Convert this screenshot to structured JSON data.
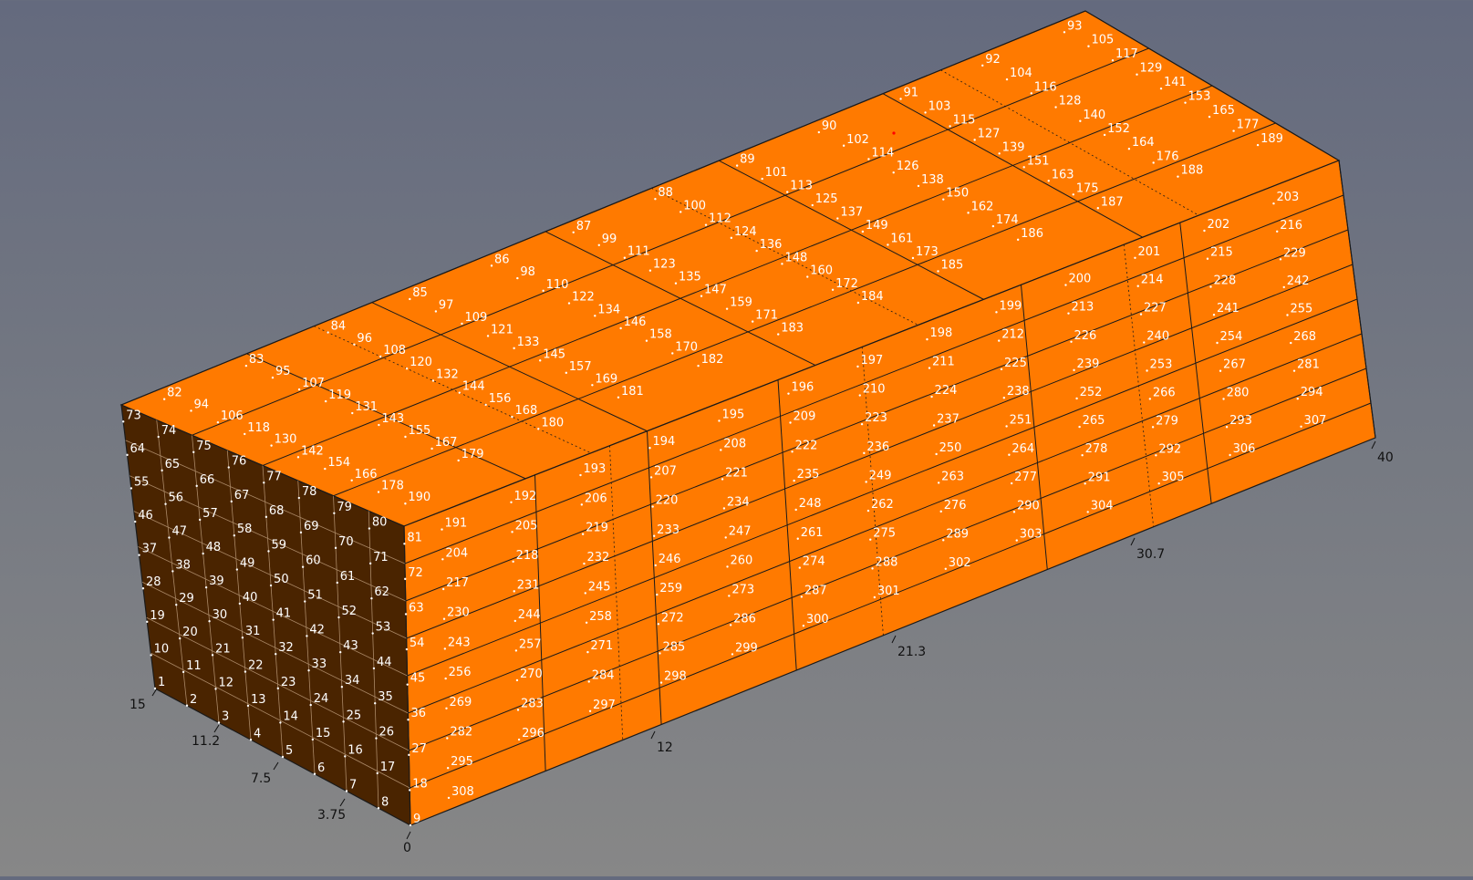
{
  "viewer": {
    "colors": {
      "background_top": "#646a7e",
      "background_bottom": "#878787",
      "face_top": "#ff7a00",
      "face_side": "#ff7a00",
      "face_end": "#4a2400",
      "edge": "#1a1a1a",
      "label": "#ffffff",
      "axis_label": "#111111",
      "marker": "#ff0000"
    }
  },
  "axes": {
    "length_ticks": [
      "0",
      "12",
      "21.3",
      "30.7",
      "40"
    ],
    "width_ticks": [
      "3.75",
      "7.5",
      "11.2",
      "15"
    ]
  },
  "mesh": {
    "labels": [
      "1",
      "2",
      "3",
      "4",
      "5",
      "6",
      "7",
      "8",
      "9",
      "10",
      "11",
      "12",
      "13",
      "14",
      "15",
      "16",
      "17",
      "18",
      "19",
      "20",
      "21",
      "22",
      "23",
      "24",
      "25",
      "26",
      "27",
      "28",
      "29",
      "30",
      "31",
      "32",
      "33",
      "34",
      "35",
      "36",
      "37",
      "38",
      "39",
      "40",
      "41",
      "42",
      "43",
      "44",
      "45",
      "46",
      "47",
      "48",
      "49",
      "50",
      "51",
      "52",
      "53",
      "54",
      "55",
      "56",
      "57",
      "58",
      "59",
      "60",
      "61",
      "62",
      "63",
      "64",
      "65",
      "66",
      "67",
      "68",
      "69",
      "70",
      "71",
      "72",
      "73",
      "74",
      "75",
      "76",
      "77",
      "78",
      "79",
      "80",
      "81",
      "82",
      "83",
      "84",
      "85",
      "86",
      "87",
      "88",
      "89",
      "90",
      "91",
      "92",
      "93",
      "94",
      "95",
      "96",
      "97",
      "98",
      "99",
      "100",
      "101",
      "102",
      "103",
      "104",
      "105",
      "106",
      "107",
      "108",
      "109",
      "110",
      "111",
      "112",
      "113",
      "114",
      "115",
      "116",
      "117",
      "118",
      "119",
      "120",
      "121",
      "122",
      "123",
      "124",
      "125",
      "126",
      "127",
      "128",
      "129",
      "130",
      "131",
      "132",
      "133",
      "134",
      "135",
      "136",
      "137",
      "138",
      "139",
      "140",
      "141",
      "142",
      "143",
      "144",
      "145",
      "146",
      "147",
      "148",
      "149",
      "150",
      "151",
      "152",
      "153",
      "154",
      "155",
      "156",
      "157",
      "158",
      "159",
      "160",
      "161",
      "162",
      "163",
      "164",
      "165",
      "166",
      "167",
      "168",
      "169",
      "170",
      "171",
      "172",
      "173",
      "174",
      "175",
      "176",
      "177",
      "178",
      "179",
      "180",
      "181",
      "182",
      "183",
      "184",
      "185",
      "186",
      "187",
      "188",
      "189",
      "190",
      "191",
      "192",
      "193",
      "194",
      "195",
      "196",
      "197",
      "198",
      "199",
      "200",
      "201",
      "202",
      "203",
      "204",
      "205",
      "206",
      "207",
      "208",
      "209",
      "210",
      "211",
      "212",
      "213",
      "214",
      "215",
      "216",
      "217",
      "218",
      "219",
      "220",
      "221",
      "222",
      "223",
      "224",
      "225",
      "226",
      "227",
      "228",
      "229",
      "230",
      "231",
      "232",
      "233",
      "234",
      "235",
      "236",
      "237",
      "238",
      "239",
      "240",
      "241",
      "242",
      "243",
      "244",
      "245",
      "246",
      "247",
      "248",
      "249",
      "250",
      "251",
      "252",
      "253",
      "254",
      "255",
      "256",
      "257",
      "258",
      "259",
      "260",
      "261",
      "262",
      "263",
      "264",
      "265",
      "266",
      "267",
      "268",
      "269",
      "270",
      "271",
      "272",
      "273",
      "274",
      "275",
      "276",
      "277",
      "278",
      "279",
      "280",
      "281",
      "282",
      "283",
      "284",
      "285",
      "286",
      "287",
      "288",
      "289",
      "290",
      "291",
      "292",
      "293",
      "294",
      "295",
      "296",
      "297",
      "298",
      "299",
      "300",
      "301",
      "302",
      "303",
      "304",
      "305",
      "306",
      "307",
      "308"
    ]
  }
}
